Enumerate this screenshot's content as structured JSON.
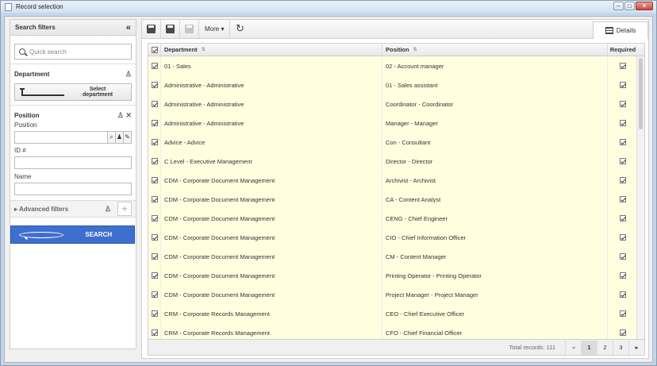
{
  "window": {
    "title": "Record selection"
  },
  "sidebar": {
    "title": "Search filters",
    "quick_search_placeholder": "Quick search",
    "department": {
      "label": "Department",
      "button": "Select department"
    },
    "position": {
      "section": "Position",
      "position_label": "Position",
      "id_label": "ID #",
      "name_label": "Name"
    },
    "advanced": "Advanced filters",
    "search_button": "SEARCH"
  },
  "toolbar": {
    "more": "More",
    "details_tab": "Details"
  },
  "grid": {
    "headers": {
      "department": "Department",
      "position": "Position",
      "required": "Required"
    },
    "rows": [
      {
        "department": "01 - Sales",
        "position": "02 - Account manager",
        "required": true
      },
      {
        "department": "Administrative - Administrative",
        "position": "01 - Sales assistant",
        "required": true
      },
      {
        "department": "Administrative - Administrative",
        "position": "Coordinator - Coordinator",
        "required": true
      },
      {
        "department": "Administrative - Administrative",
        "position": "Manager - Manager",
        "required": true
      },
      {
        "department": "Advice - Advice",
        "position": "Con - Consultant",
        "required": true
      },
      {
        "department": "C Level - Executive Management",
        "position": "Director - Director",
        "required": true
      },
      {
        "department": "CDM - Corporate Document Management",
        "position": "Archivist - Archivist",
        "required": true
      },
      {
        "department": "CDM - Corporate Document Management",
        "position": "CA - Content Analyst",
        "required": true
      },
      {
        "department": "CDM - Corporate Document Management",
        "position": "CENG - Chief Engineer",
        "required": true
      },
      {
        "department": "CDM - Corporate Document Management",
        "position": "CIO - Chief Information Officer",
        "required": true
      },
      {
        "department": "CDM - Corporate Document Management",
        "position": "CM - Content Manager",
        "required": true
      },
      {
        "department": "CDM - Corporate Document Management",
        "position": "Printing Operator - Printing Operator",
        "required": true
      },
      {
        "department": "CDM - Corporate Document Management",
        "position": "Project Manager - Project Manager",
        "required": true
      },
      {
        "department": "CRM - Corporate Records Management",
        "position": "CEO - Chief Executive Officer",
        "required": true
      },
      {
        "department": "CRM - Corporate Records Management",
        "position": "CFO - Chief Financial Officer",
        "required": true
      }
    ],
    "total_records": "Total records: 111",
    "pages": [
      "1",
      "2",
      "3"
    ],
    "current_page": "1"
  }
}
